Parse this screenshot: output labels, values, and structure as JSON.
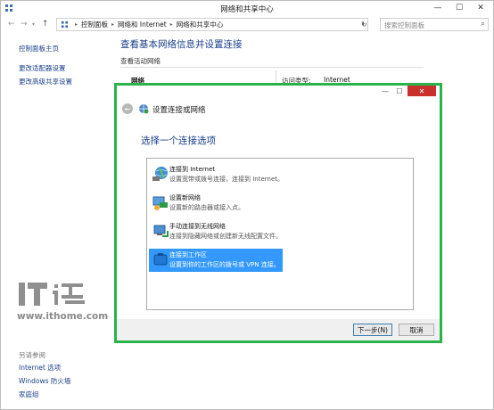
{
  "window": {
    "title": "网络和共享中心",
    "controls": {
      "minimize": "—",
      "maximize": "☐",
      "close": "✕"
    }
  },
  "navbar": {
    "back": "←",
    "forward": "→",
    "recent": "▾",
    "up": "↑",
    "breadcrumb": [
      "控制面板",
      "网络和 Internet",
      "网络和共享中心"
    ],
    "breadcrumb_sep": "▸",
    "refresh": "↻",
    "search_placeholder": "搜索控制面板"
  },
  "left_pane": {
    "home": "控制面板主页",
    "change_adapter": "更改适配器设置",
    "change_sharing": "更改高级共享设置",
    "see_also": "另请参阅",
    "internet_options": "Internet 选项",
    "firewall": "Windows 防火墙",
    "homegroup": "家庭组"
  },
  "content": {
    "heading": "查看基本网络信息并设置连接",
    "active_networks_label": "查看活动网络",
    "network_name": "网络",
    "access_type_label": "访问类型:",
    "access_type_value": "Internet"
  },
  "watermark": {
    "logo_text": "IT之家",
    "url": "www.ithome.com"
  },
  "dialog": {
    "title": "设置连接或网络",
    "back": "←",
    "heading": "选择一个连接选项",
    "options": [
      {
        "title": "连接到 Internet",
        "desc": "设置宽带或拨号连接，连接到 Internet。",
        "icon": "globe-connect-icon",
        "selected": false
      },
      {
        "title": "设置新网络",
        "desc": "设置新的路由器或接入点。",
        "icon": "router-setup-icon",
        "selected": false
      },
      {
        "title": "手动连接到无线网络",
        "desc": "连接到隐藏网络或创建新无线配置文件。",
        "icon": "wireless-manual-icon",
        "selected": false
      },
      {
        "title": "连接到工作区",
        "desc": "设置到你的工作区的拨号或 VPN 连接。",
        "icon": "workplace-icon",
        "selected": true
      }
    ],
    "next_label": "下一步(N)",
    "cancel_label": "取消"
  },
  "colors": {
    "dialog_border": "#29b34a",
    "selection": "#3399ff",
    "link": "#1a3f8a",
    "close_button": "#c9302c"
  }
}
